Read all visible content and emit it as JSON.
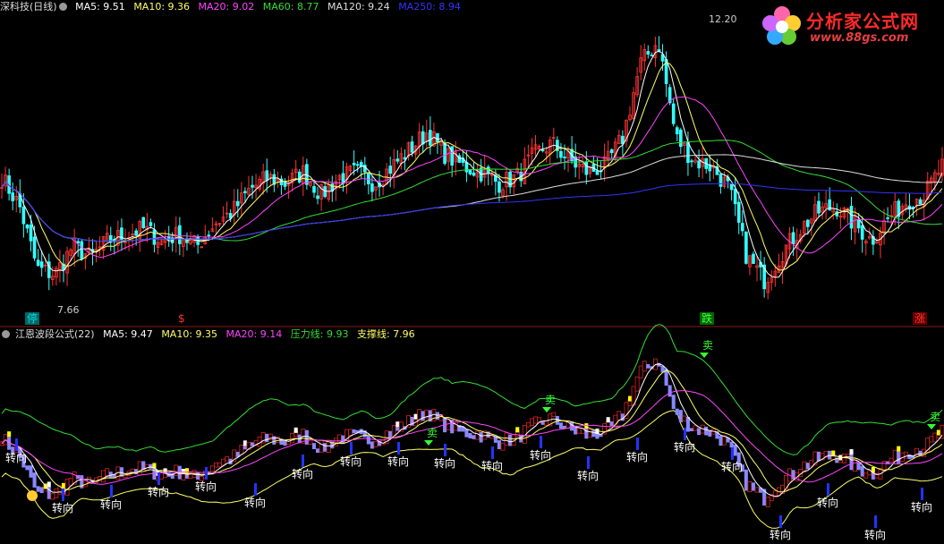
{
  "top_legend": {
    "name": "深科技(日线)",
    "items": [
      {
        "text": "MA5: 9.51",
        "color": "#ffffff"
      },
      {
        "text": "MA10: 9.36",
        "color": "#ffff66"
      },
      {
        "text": "MA20: 9.02",
        "color": "#ff44ff"
      },
      {
        "text": "MA60: 8.77",
        "color": "#33dd33"
      },
      {
        "text": "MA120: 9.24",
        "color": "#dddddd"
      },
      {
        "text": "MA250: 8.94",
        "color": "#3333ff"
      }
    ]
  },
  "bottom_legend": {
    "name": "江恩波段公式(22)",
    "items": [
      {
        "text": "MA5: 9.47",
        "color": "#ffffff"
      },
      {
        "text": "MA10: 9.35",
        "color": "#ffff66"
      },
      {
        "text": "MA20: 9.14",
        "color": "#ff44ff"
      },
      {
        "text": "压力线: 9.93",
        "color": "#33dd33"
      },
      {
        "text": "支撑线: 7.96",
        "color": "#ffff66"
      }
    ]
  },
  "logo": {
    "title": "分析家公式网",
    "url": "www.88gs.com"
  },
  "price_labels": {
    "high": "12.20",
    "low": "7.66"
  },
  "markers": [
    {
      "text": "停",
      "color": "#00dddd"
    },
    {
      "text": "$",
      "color": "#ff3333"
    },
    {
      "text": "跌",
      "color": "#44ff44"
    },
    {
      "text": "涨",
      "color": "#ff3333"
    }
  ],
  "signals": {
    "turn": "转向",
    "sell": "卖",
    "turn_count": 18
  },
  "chart_data": {
    "type": "candlestick",
    "price_ylim": [
      7.3,
      12.4
    ],
    "close_path": [
      9.6,
      9.1,
      8.0,
      7.9,
      8.4,
      8.2,
      8.5,
      8.6,
      8.7,
      8.5,
      8.6,
      8.4,
      8.8,
      9.0,
      9.4,
      9.6,
      9.5,
      9.7,
      9.3,
      9.6,
      9.7,
      9.5,
      9.8,
      10.1,
      10.4,
      10.0,
      9.8,
      9.7,
      9.5,
      9.6,
      10.0,
      10.2,
      9.9,
      9.7,
      9.8,
      10.3,
      11.6,
      12.0,
      10.3,
      9.9,
      9.8,
      9.4,
      8.2,
      7.8,
      8.3,
      8.7,
      9.0,
      9.1,
      8.8,
      8.5,
      8.9,
      9.2,
      9.3,
      9.8
    ]
  }
}
